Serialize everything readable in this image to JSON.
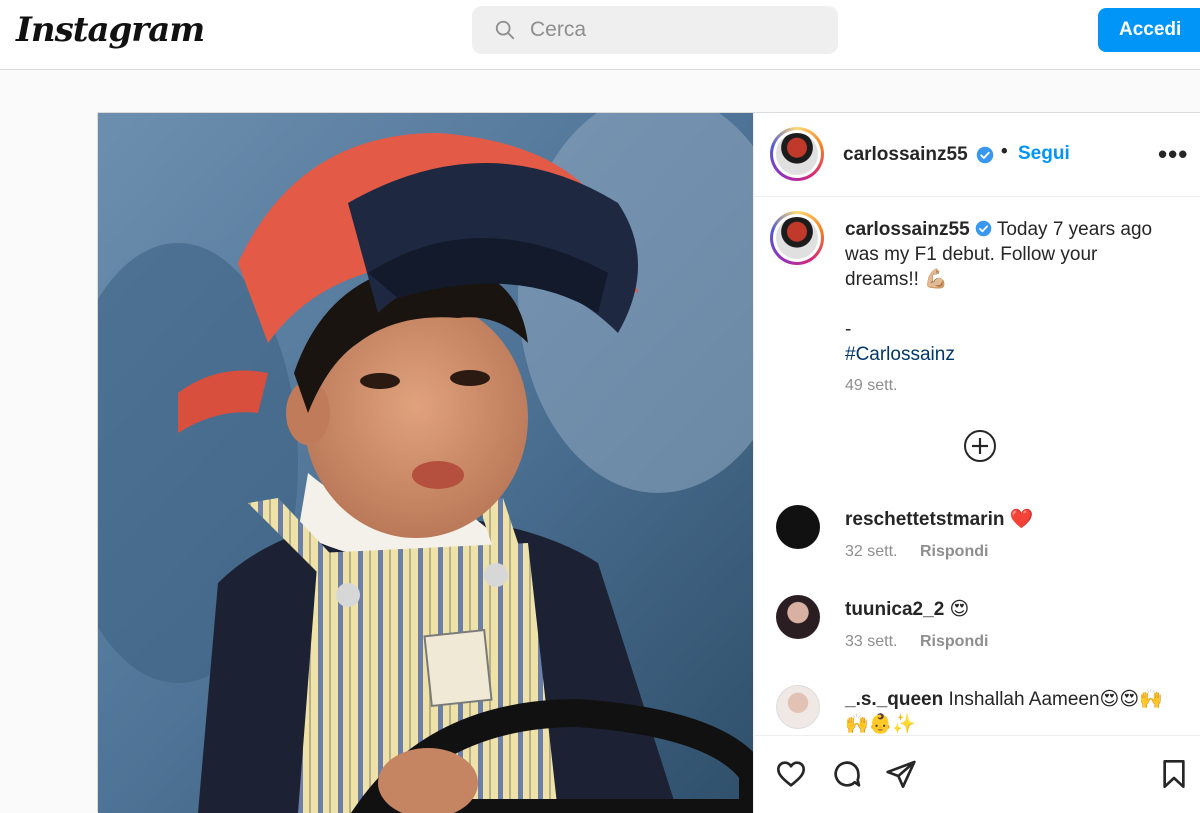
{
  "nav": {
    "logo": "Instagram",
    "search_placeholder": "Cerca",
    "login_label": "Accedi"
  },
  "post": {
    "author": "carlossainz55",
    "follow_label": "Segui",
    "more_label": "•••",
    "separator": "•",
    "caption": {
      "user": "carlossainz55",
      "lines": [
        "Today 7 years ago",
        "was my F1 debut. Follow your",
        "dreams!! 💪🏼",
        "",
        "-",
        "#Carlossainz"
      ],
      "time": "49 sett."
    },
    "comments": [
      {
        "user": "reschettetstmarin",
        "text": "❤️",
        "time": "32 sett.",
        "reply": "Rispondi"
      },
      {
        "user": "tuunica2_2",
        "text": "😍",
        "time": "33 sett.",
        "reply": "Rispondi"
      },
      {
        "user": "_.s._queen",
        "text": "Inshallah Aameen😍😍🙌",
        "text2": "🙌👶✨"
      }
    ]
  },
  "colors": {
    "accent": "#0095f6",
    "hashtag": "#00376b",
    "muted": "#8e8e8e"
  },
  "icons": [
    "search-icon",
    "verified-icon",
    "more-icon",
    "add-comment-icon",
    "heart-icon",
    "comment-icon",
    "share-icon",
    "bookmark-icon"
  ]
}
